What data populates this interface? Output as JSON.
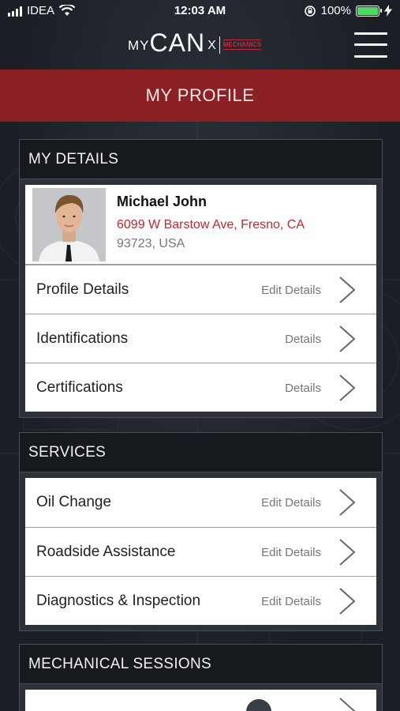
{
  "status_bar": {
    "carrier": "IDEA",
    "time": "12:03 AM",
    "battery": "100%"
  },
  "header": {
    "logo_my": "MY",
    "logo_can": "CAN",
    "logo_x": "X",
    "logo_mechanics": "MECHANICS"
  },
  "page_title": "MY PROFILE",
  "my_details": {
    "heading": "MY DETAILS",
    "profile": {
      "name": "Michael John",
      "address_line1": "6099 W Barstow Ave, Fresno, CA",
      "address_line2": "93723, USA"
    },
    "rows": [
      {
        "label": "Profile Details",
        "action": "Edit Details"
      },
      {
        "label": "Identifications",
        "action": "Details"
      },
      {
        "label": "Certifications",
        "action": "Details"
      }
    ]
  },
  "services": {
    "heading": "SERVICES",
    "rows": [
      {
        "label": "Oil Change",
        "action": "Edit Details"
      },
      {
        "label": "Roadside Assistance",
        "action": "Edit Details"
      },
      {
        "label": "Diagnostics & Inspection",
        "action": "Edit Details"
      }
    ]
  },
  "mechanical_sessions": {
    "heading": "MECHANICAL SESSIONS"
  },
  "colors": {
    "title_bar": "#8b2025",
    "address": "#c0282f",
    "battery": "#4cd964"
  }
}
